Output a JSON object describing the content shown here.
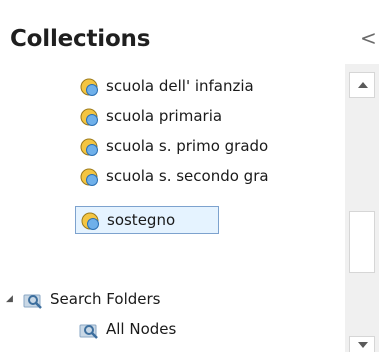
{
  "panel": {
    "title": "Collections",
    "collapse_glyph": "<"
  },
  "tree": {
    "collections": [
      {
        "label": "scuola dell' infanzia",
        "icon": "collection-icon",
        "selected": false
      },
      {
        "label": "scuola primaria",
        "icon": "collection-icon",
        "selected": false
      },
      {
        "label": "scuola s. primo grado",
        "icon": "collection-icon",
        "selected": false
      },
      {
        "label": "scuola s. secondo gra",
        "icon": "collection-icon",
        "selected": false
      },
      {
        "label": "sostegno",
        "icon": "collection-icon",
        "selected": true
      }
    ],
    "search_folders": {
      "label": "Search Folders",
      "icon": "search-folder-icon",
      "expanded": true,
      "children": [
        {
          "label": "All Nodes",
          "icon": "search-folder-icon"
        }
      ]
    }
  },
  "colors": {
    "selection_bg": "#e5f3ff",
    "selection_border": "#7da2ce",
    "collection_icon_blue": "#3b8fd8",
    "collection_icon_yellow": "#f4c542",
    "search_folder_icon": "#8aa7c4"
  }
}
